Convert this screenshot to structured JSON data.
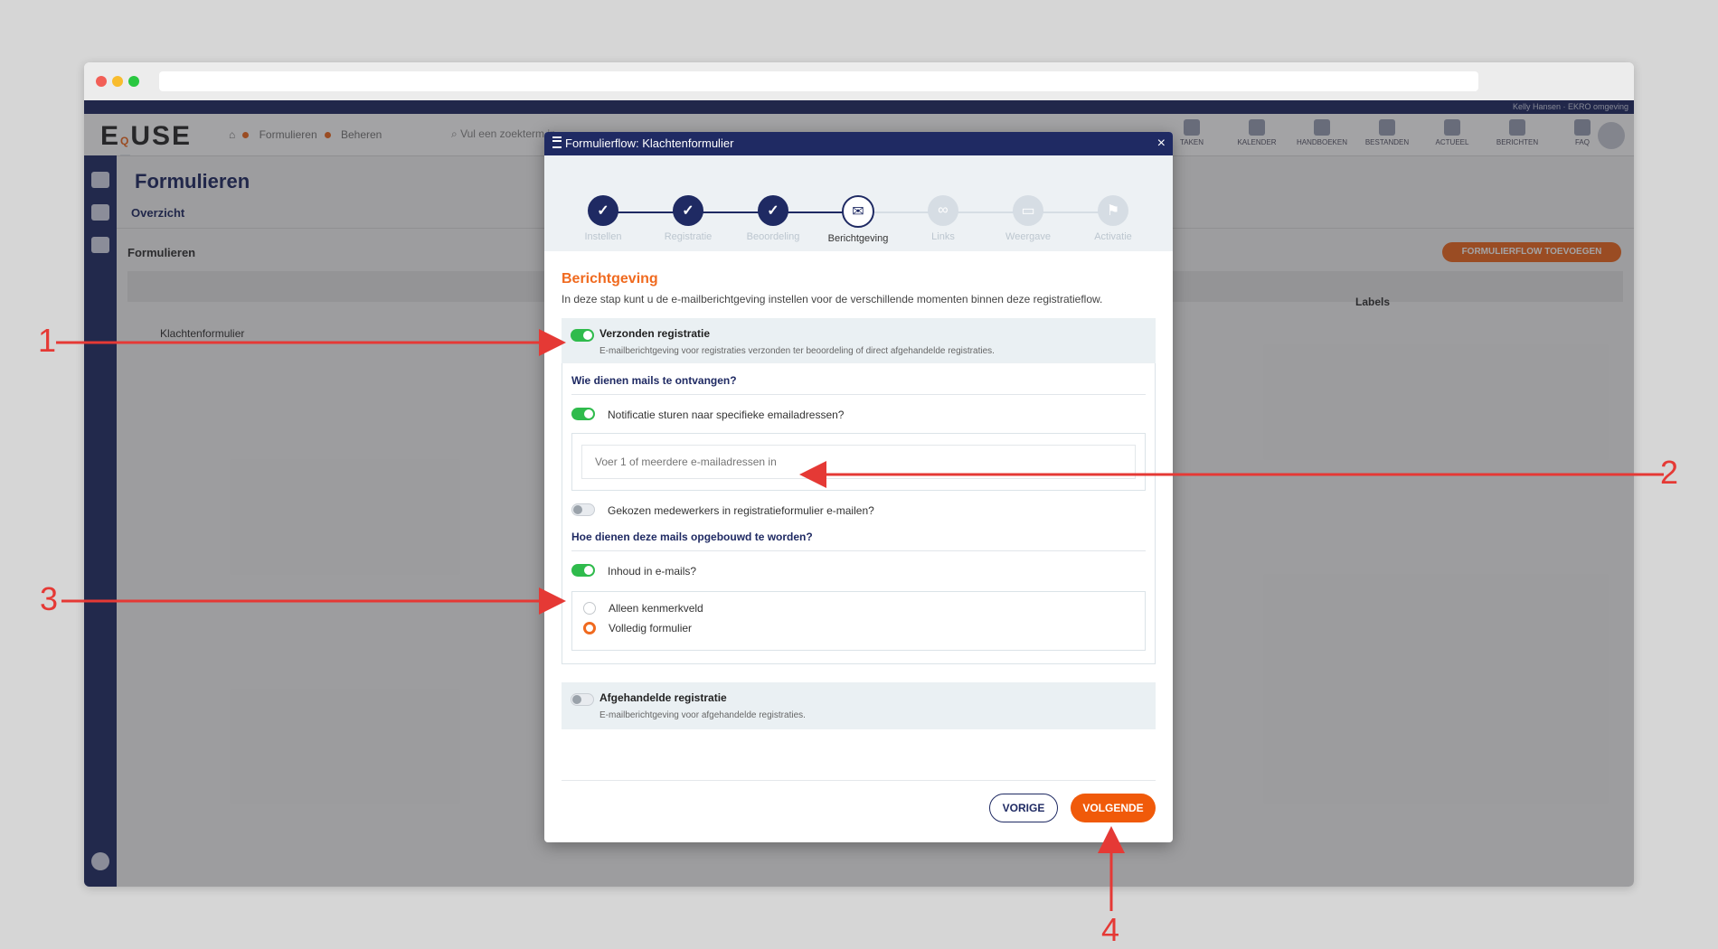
{
  "app": {
    "logo": "EQUSE",
    "user": "Kelly Hansen · EKRO omgeving",
    "crumbs": [
      "Formulieren",
      "Beheren"
    ],
    "search_placeholder": "Vul een zoekterm in",
    "top_icons": [
      {
        "name": "tasks-icon",
        "label": "TAKEN"
      },
      {
        "name": "calendar-icon",
        "label": "KALENDER"
      },
      {
        "name": "manuals-icon",
        "label": "HANDBOEKEN"
      },
      {
        "name": "files-icon",
        "label": "BESTANDEN"
      },
      {
        "name": "news-icon",
        "label": "ACTUEEL"
      },
      {
        "name": "messages-icon",
        "label": "BERICHTEN"
      },
      {
        "name": "faq-icon",
        "label": "FAQ"
      }
    ],
    "page_title": "Formulieren",
    "subnav": "Overzicht",
    "panel_title": "Formulieren",
    "add_button": "FORMULIERFLOW TOEVOEGEN",
    "labels_col": "Labels",
    "row": "Klachtenformulier"
  },
  "modal": {
    "title": "Formulierflow: Klachtenformulier",
    "close": "×",
    "steps": [
      {
        "label": "Instellen",
        "state": "done",
        "icon": "check-icon"
      },
      {
        "label": "Registratie",
        "state": "done",
        "icon": "check-icon"
      },
      {
        "label": "Beoordeling",
        "state": "done",
        "icon": "check-icon"
      },
      {
        "label": "Berichtgeving",
        "state": "current",
        "icon": "envelope-icon"
      },
      {
        "label": "Links",
        "state": "future",
        "icon": "link-icon"
      },
      {
        "label": "Weergave",
        "state": "future",
        "icon": "monitor-icon"
      },
      {
        "label": "Activatie",
        "state": "future",
        "icon": "flag-icon"
      }
    ],
    "heading": "Berichtgeving",
    "intro": "In deze stap kunt u de e-mailberichtgeving instellen voor de verschillende momenten binnen deze registratieflow.",
    "section1": {
      "title": "Verzonden registratie",
      "desc": "E-mailberichtgeving voor registraties verzonden ter beoordeling of direct afgehandelde registraties.",
      "enabled": true
    },
    "q1": "Wie dienen mails te ontvangen?",
    "opt_specific": "Notificatie sturen naar specifieke emailadressen?",
    "email_placeholder": "Voer 1 of meerdere e-mailadressen in",
    "opt_employees": "Gekozen medewerkers in registratieformulier e-mailen?",
    "q2": "Hoe dienen deze mails opgebouwd te worden?",
    "opt_content": "Inhoud in e-mails?",
    "radio_options": [
      "Alleen kenmerkveld",
      "Volledig formulier"
    ],
    "radio_selected": "Volledig formulier",
    "section2": {
      "title": "Afgehandelde registratie",
      "desc": "E-mailberichtgeving voor afgehandelde registraties.",
      "enabled": false
    },
    "prev_label": "VORIGE",
    "next_label": "VOLGENDE"
  },
  "annotations": [
    "1",
    "2",
    "3",
    "4"
  ],
  "colors": {
    "navy": "#1f2a63",
    "orange": "#f06a1f",
    "green": "#2fbb4c",
    "arrow": "#e53935"
  }
}
